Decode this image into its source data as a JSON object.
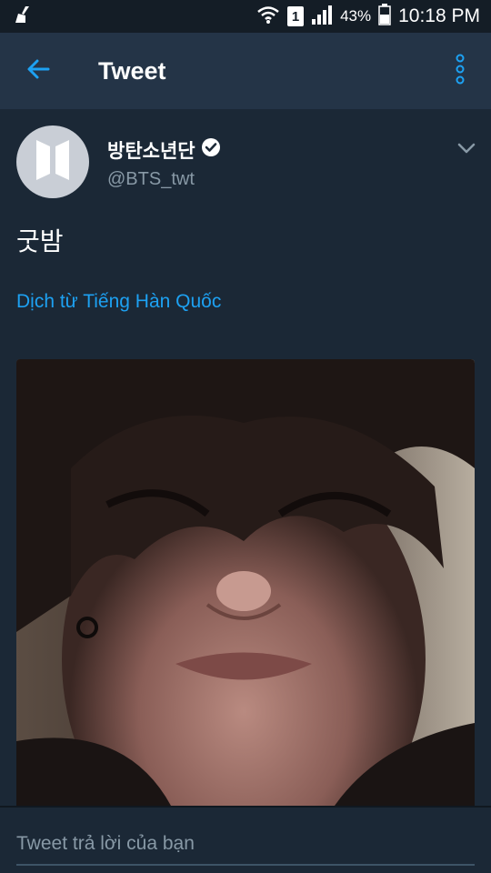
{
  "status_bar": {
    "sim_label": "1",
    "battery_percent": "43%",
    "time": "10:18 PM"
  },
  "toolbar": {
    "title": "Tweet",
    "back_icon": "arrow-left-icon",
    "menu_icon": "more-vertical-icon"
  },
  "tweet": {
    "display_name": "방탄소년단",
    "verified": true,
    "handle": "@BTS_twt",
    "text": "굿밤",
    "translate_label": "Dịch từ Tiếng Hàn Quốc"
  },
  "reply": {
    "placeholder": "Tweet trả lời của bạn",
    "value": ""
  },
  "colors": {
    "accent": "#1da1f2",
    "background": "#1b2836",
    "toolbar": "#243447",
    "secondary_text": "#8899a6"
  }
}
